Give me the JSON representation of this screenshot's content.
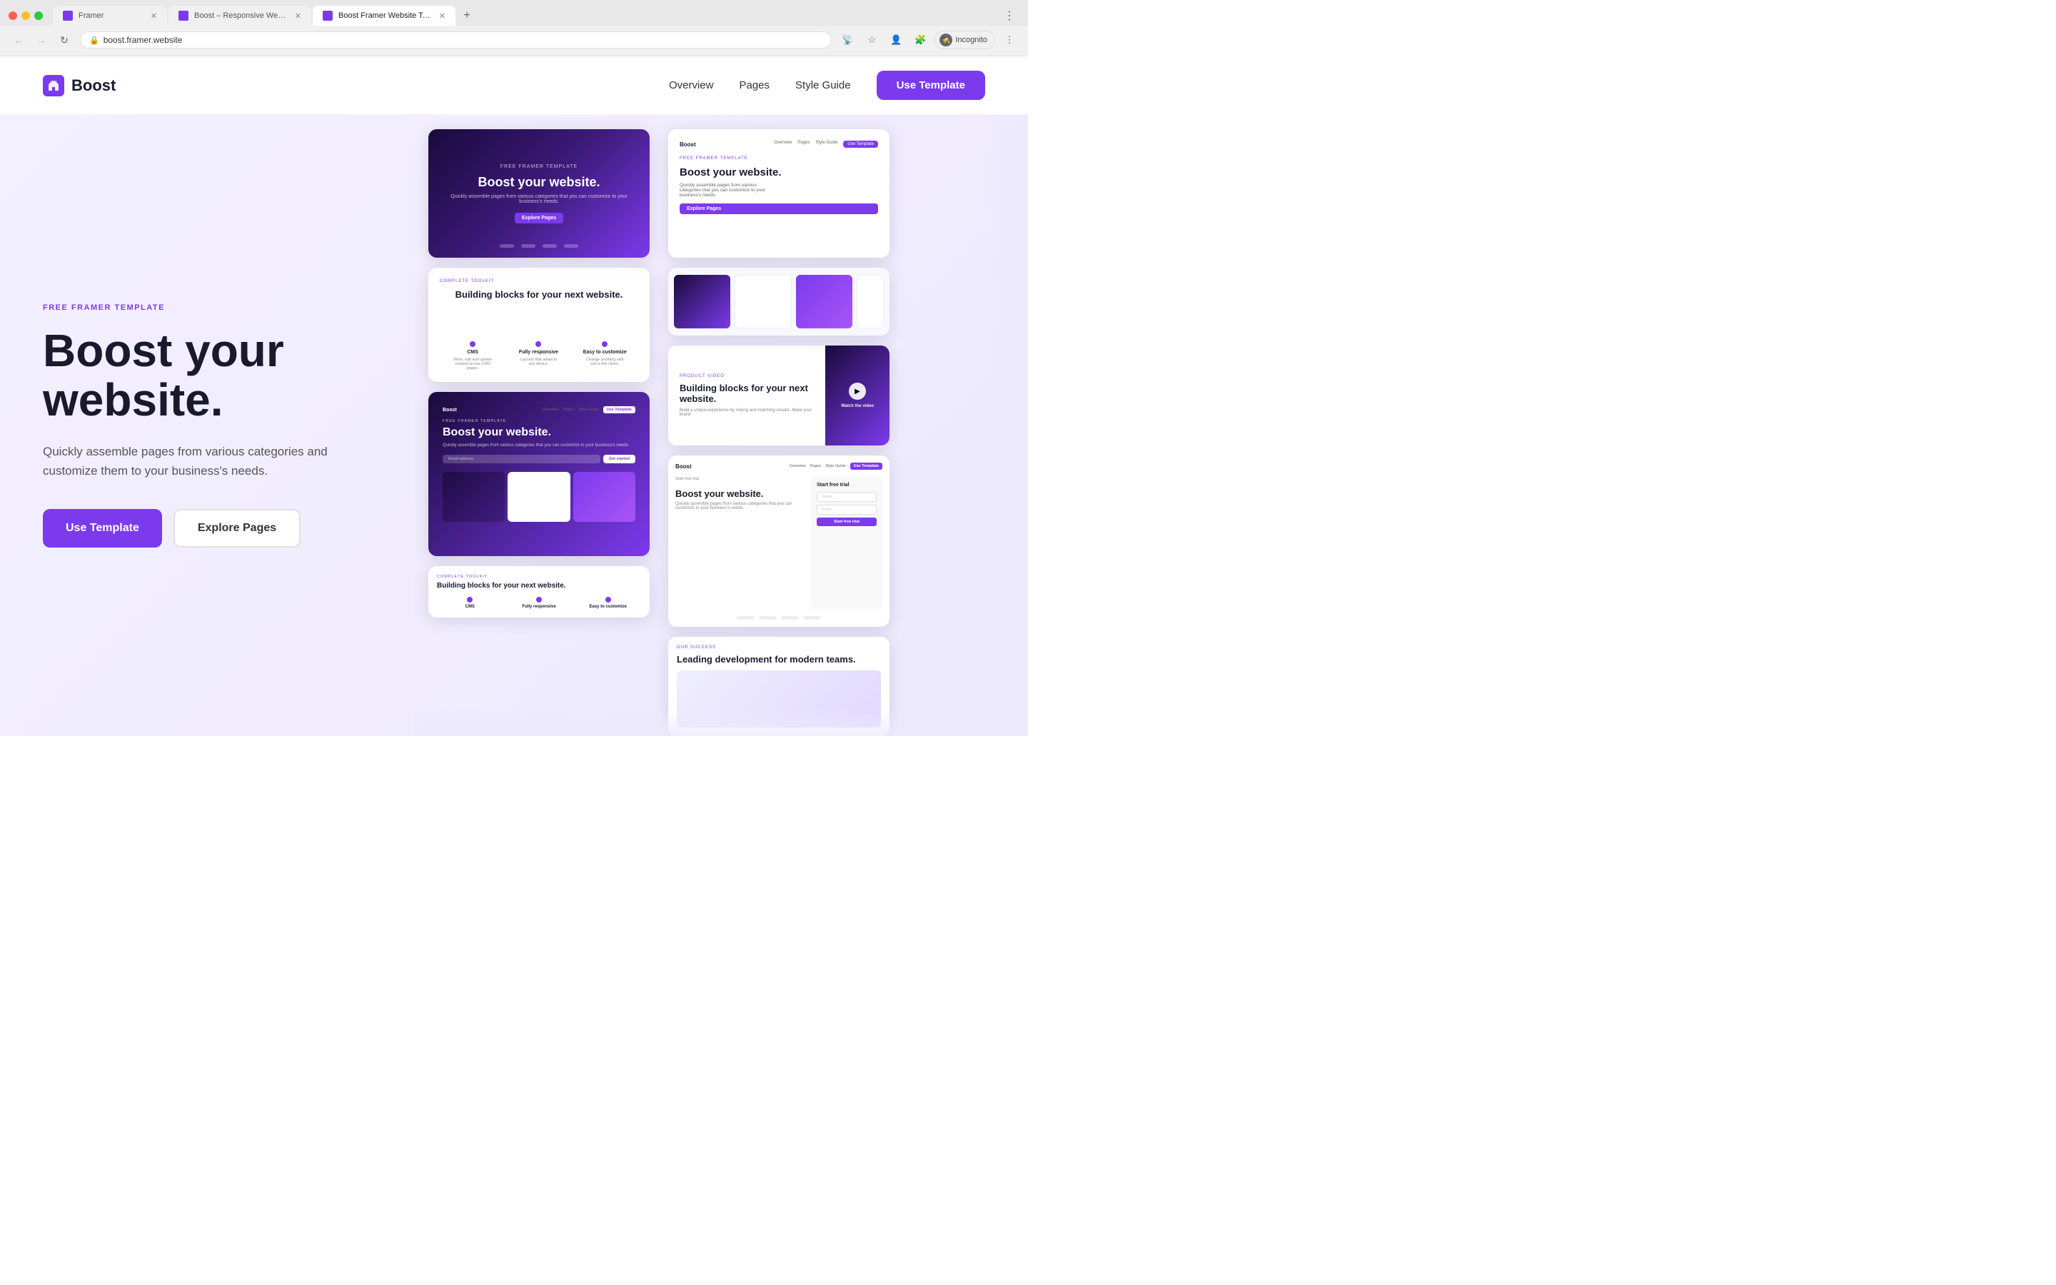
{
  "browser": {
    "tabs": [
      {
        "id": "framer",
        "title": "Framer",
        "active": false
      },
      {
        "id": "boost-responsive",
        "title": "Boost – Responsive Website T...",
        "active": false
      },
      {
        "id": "boost-framer",
        "title": "Boost Framer Website Templat...",
        "active": true
      }
    ],
    "url": "boost.framer.website",
    "incognito_label": "Incognito"
  },
  "nav": {
    "logo_text": "Boost",
    "links": [
      "Overview",
      "Pages",
      "Style Guide"
    ],
    "cta_label": "Use Template"
  },
  "hero": {
    "badge": "FREE FRAMER TEMPLATE",
    "title": "Boost your website.",
    "description": "Quickly assemble pages from various categories and customize them to your business's needs.",
    "btn_primary": "Use Template",
    "btn_secondary": "Explore Pages"
  },
  "screenshots": {
    "dark_hero": {
      "badge": "FREE FRAMER TEMPLATE",
      "title": "Boost your website.",
      "subtitle": "Quickly assemble pages from various categories that you can customize to your business's needs.",
      "btn": "Explore Pages"
    },
    "toolkit": {
      "badge": "COMPLETE TOOLKIT",
      "title": "Building blocks for your next website.",
      "features": [
        {
          "label": "CMS",
          "desc": "Write, edit and update content across CMS pages."
        },
        {
          "label": "Fully responsive",
          "desc": "Layouts that adapt to any device."
        },
        {
          "label": "Easy to customize",
          "desc": "Change anything with just a few clicks."
        }
      ]
    },
    "light_hero": {
      "badge": "FREE FRAMER TEMPLATE",
      "title": "Boost your website.",
      "desc": "Quickly assemble pages from various categories that you can customize to your business's needs.",
      "btn": "Explore Pages"
    },
    "product_video": {
      "badge": "PRODUCT VIDEO",
      "title": "Building blocks for your next website.",
      "desc": "Build a unique experience by mixing and matching visuals. Make your brand",
      "watch_text": "Watch the video"
    },
    "boost_page": {
      "logo": "Boost",
      "badge": "FREE FRAMER TEMPLATE",
      "title": "Boost your website.",
      "desc": "Quickly assemble pages from various categories that you can customize to your business's needs.",
      "email_placeholder": "Email address",
      "btn": "Get started"
    },
    "framer_signup": {
      "badge": "Start free trial",
      "title": "Boost your website.",
      "desc": "Quickly assemble pages from various categories that you can customize to your business's needs.",
      "name_placeholder": "Name",
      "email_placeholder": "Email",
      "btn": "Start free trial"
    },
    "success": {
      "badge": "OUR SUCCESS",
      "title": "Leading development for modern teams."
    }
  }
}
